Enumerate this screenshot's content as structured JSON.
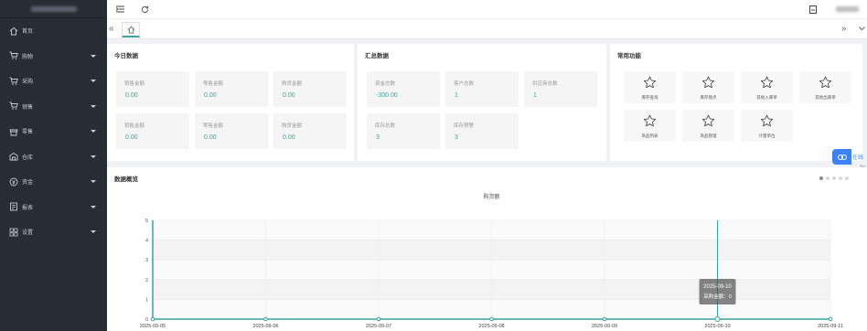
{
  "sidebar": {
    "items": [
      {
        "label": "首页",
        "icon": "home-icon",
        "has_caret": false
      },
      {
        "label": "购物",
        "icon": "cart-icon",
        "has_caret": true
      },
      {
        "label": "采购",
        "icon": "cart-icon",
        "has_caret": true
      },
      {
        "label": "销售",
        "icon": "cart-icon",
        "has_caret": true
      },
      {
        "label": "零售",
        "icon": "shop-icon",
        "has_caret": true
      },
      {
        "label": "仓库",
        "icon": "warehouse-icon",
        "has_caret": true
      },
      {
        "label": "资金",
        "icon": "money-icon",
        "has_caret": true
      },
      {
        "label": "报表",
        "icon": "report-icon",
        "has_caret": true
      },
      {
        "label": "设置",
        "icon": "grid-icon",
        "has_caret": true
      }
    ]
  },
  "today": {
    "title": "今日数据",
    "stats": [
      {
        "label": "销售金额",
        "value": "0.00"
      },
      {
        "label": "零售金额",
        "value": "0.00"
      },
      {
        "label": "购货金额",
        "value": "0.00"
      },
      {
        "label": "销售金额",
        "value": "0.00"
      },
      {
        "label": "零售金额",
        "value": "0.00"
      },
      {
        "label": "购货金额",
        "value": "0.00"
      }
    ]
  },
  "summary": {
    "title": "汇总数据",
    "stats": [
      {
        "label": "资金总数",
        "value": "-300.00"
      },
      {
        "label": "客户总数",
        "value": "1"
      },
      {
        "label": "供应商总数",
        "value": "1"
      },
      {
        "label": "库存总数",
        "value": "3"
      },
      {
        "label": "库存预警",
        "value": "3"
      }
    ]
  },
  "quick": {
    "title": "常用功能",
    "items": [
      {
        "label": "库存查询"
      },
      {
        "label": "库存盘点"
      },
      {
        "label": "其他入库单"
      },
      {
        "label": "其他出库单"
      },
      {
        "label": "商品列表"
      },
      {
        "label": "商品管理"
      },
      {
        "label": "计量单位"
      }
    ]
  },
  "overview": {
    "title": "数据概览"
  },
  "floating": {
    "label": "在线",
    "sub": "So"
  },
  "tooltip": {
    "date": "2025-09-10",
    "text": "采购金额：0"
  },
  "chart_data": {
    "type": "line",
    "title": "购货额",
    "x": [
      "2025-09-05",
      "2025-09-06",
      "2025-09-07",
      "2025-09-08",
      "2025-09-09",
      "2025-09-10",
      "2025-09-11"
    ],
    "series": [
      {
        "name": "采购金额",
        "values": [
          0,
          0,
          0,
          0,
          0,
          0,
          0
        ]
      }
    ],
    "ylim": [
      0,
      5
    ],
    "yticks": [
      0,
      1,
      2,
      3,
      4,
      5
    ],
    "highlight_index": 5,
    "color": "#3aa39b"
  },
  "colors": {
    "accent": "#3aa39b",
    "sidebar": "#282c34"
  }
}
